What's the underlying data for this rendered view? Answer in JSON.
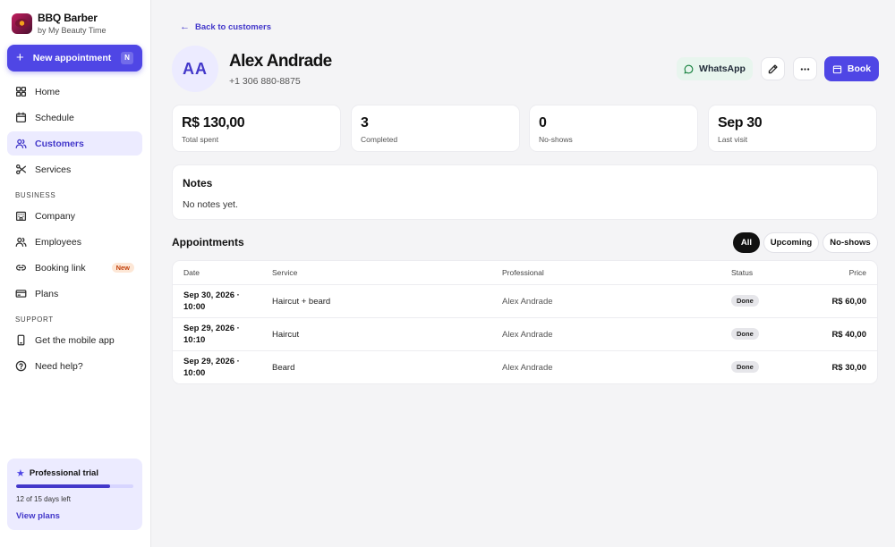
{
  "brand": {
    "name": "BBQ Barber",
    "sub": "by My Beauty Time"
  },
  "sidebar": {
    "new_appointment": {
      "label": "New appointment",
      "shortcut": "N"
    },
    "main_items": [
      {
        "label": "Home",
        "icon": "home-icon"
      },
      {
        "label": "Schedule",
        "icon": "calendar-icon"
      },
      {
        "label": "Customers",
        "icon": "users-icon",
        "active": true
      },
      {
        "label": "Services",
        "icon": "scissors-icon"
      }
    ],
    "business_label": "BUSINESS",
    "business_items": [
      {
        "label": "Company",
        "icon": "building-icon"
      },
      {
        "label": "Employees",
        "icon": "users-icon"
      },
      {
        "label": "Booking link",
        "icon": "link-icon",
        "badge": "New"
      },
      {
        "label": "Plans",
        "icon": "credit-card-icon"
      }
    ],
    "support_label": "SUPPORT",
    "support_items": [
      {
        "label": "Get the mobile app",
        "icon": "smartphone-icon"
      },
      {
        "label": "Need help?",
        "icon": "help-circle-icon"
      }
    ],
    "trial": {
      "title": "Professional trial",
      "days_text": "12 of 15 days left",
      "progress": 0.8,
      "link": "View plans"
    }
  },
  "header": {
    "back_label": "Back to customers",
    "initials": "AA",
    "name": "Alex Andrade",
    "phone": "+1 306 880-8875",
    "whatsapp_label": "WhatsApp",
    "book_label": "Book"
  },
  "stats": [
    {
      "value": "R$ 130,00",
      "label": "Total spent"
    },
    {
      "value": "3",
      "label": "Completed"
    },
    {
      "value": "0",
      "label": "No-shows"
    },
    {
      "value": "Sep 30",
      "label": "Last visit"
    }
  ],
  "notes": {
    "title": "Notes",
    "body": "No notes yet."
  },
  "appointments": {
    "title": "Appointments",
    "filters": [
      {
        "label": "All",
        "active": true
      },
      {
        "label": "Upcoming",
        "active": false
      },
      {
        "label": "No-shows",
        "active": false
      }
    ],
    "columns": {
      "date": "Date",
      "service": "Service",
      "professional": "Professional",
      "status": "Status",
      "price": "Price"
    },
    "rows": [
      {
        "date": "Sep 30, 2026 · 10:00",
        "service": "Haircut + beard",
        "professional": "Alex Andrade",
        "status": "Done",
        "price": "R$ 60,00"
      },
      {
        "date": "Sep 29, 2026 · 10:10",
        "service": "Haircut",
        "professional": "Alex Andrade",
        "status": "Done",
        "price": "R$ 40,00"
      },
      {
        "date": "Sep 29, 2026 · 10:00",
        "service": "Beard",
        "professional": "Alex Andrade",
        "status": "Done",
        "price": "R$ 30,00"
      }
    ]
  },
  "colors": {
    "accent": "#4f46e5",
    "accent_soft": "#ecebff",
    "whatsapp_bg": "#e8f5ee"
  }
}
